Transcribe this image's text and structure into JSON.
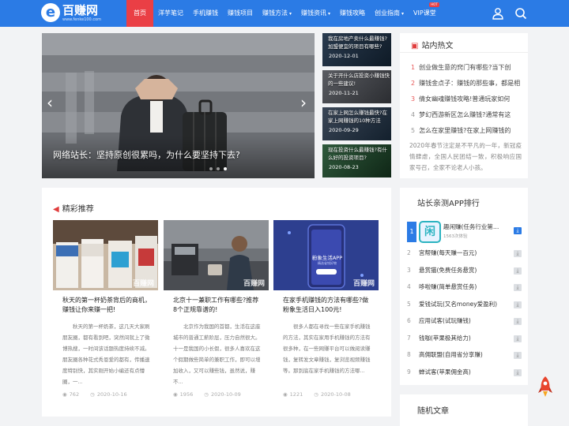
{
  "site": {
    "logo_glyph": "e",
    "name": "百赚网",
    "url": "www.fenke100.com"
  },
  "nav": {
    "items": [
      {
        "label": "首页",
        "active": true
      },
      {
        "label": "洋芋笔记"
      },
      {
        "label": "手机赚钱"
      },
      {
        "label": "赚钱项目"
      },
      {
        "label": "赚钱方法",
        "dropdown": true
      },
      {
        "label": "赚钱资讯",
        "dropdown": true
      },
      {
        "label": "赚钱攻略"
      },
      {
        "label": "创业指南",
        "dropdown": true
      },
      {
        "label": "VIP课堂",
        "badge": "HOT"
      }
    ],
    "icons": [
      "user-icon",
      "search-icon"
    ]
  },
  "slider": {
    "caption": "网络站长：坚持原创很累吗，为什么要坚持下去?",
    "prev": "‹",
    "next": "›",
    "active_index": 2,
    "dot_count": 3
  },
  "side_posts": [
    {
      "title": "我在房地产卖什么最赚钱?加盟便宜的项目有哪些?",
      "date": "2020-12-01"
    },
    {
      "title": "关于开什么店投资小赚钱快的一些建议!",
      "date": "2020-11-21"
    },
    {
      "title": "在家上网怎么赚钱最快?在家上网赚钱的10种方法",
      "date": "2020-09-29"
    },
    {
      "title": "现在投资什么最赚钱?有什么好的投资项目?",
      "date": "2020-08-23"
    }
  ],
  "hot": {
    "title": "站内热文",
    "items": [
      "创业做生意的窍门有哪些?当下创",
      "赚钱金点子：赚钱的那些事，都是相",
      "倩女幽魂赚钱攻略!普通玩家如何",
      "梦幻西游新区怎么赚钱?通常有这",
      "怎么在家里赚钱?在家上网赚钱的"
    ],
    "excerpt": "2020年春节注定是不平凡的一年，新冠疫情肆虐，全国人民团结一致，积极响应国家号召，全家不论老人小孩。"
  },
  "featured": {
    "title": "精彩推荐",
    "cards": [
      {
        "watermark": "百赚网",
        "title": "秋天的第一杯奶茶背后的商机，赚钱让你来赚一把!",
        "excerpt": "秋天的第一杯奶茶，这几天大家刷朋友圈，都有看到吧，突然间就上了微博热搜，一时间该话题热度持续不减。朋友圈各种花式秀恩爱的都有，传播速度特别快，其实刚开始小编还有点懵圈，一...",
        "views": "762",
        "date": "2020-10-16"
      },
      {
        "watermark": "百赚网",
        "title": "北京十一兼职工作有哪些?推荐8个正规靠谱的!",
        "excerpt": "北京作为我国的首都，生活在这座城市的普通工薪阶层，压力自然很大。十一是我国的小长假，很多人喜欢在这个假期做些简单的兼职工作，即可以增加收入，又可以赚些钱，虽然说，赚不...",
        "views": "1956",
        "date": "2020-10-09"
      },
      {
        "watermark": "百赚网",
        "title": "在家手机赚钱的方法有哪些?做粉象生活日入100元!",
        "excerpt": "很多人都在寻找一些在家手机赚钱的方法，其实在家用手机赚钱的方法有很多种，在一些网赚平台可以做阅读赚钱，复转发文章赚钱，复浏览视频赚钱等。那到底在家手机赚钱的方法哪...",
        "views": "1221",
        "date": "2020-10-08",
        "app_name": "粉象生活APP",
        "app_sub": "精选省钱好物"
      }
    ]
  },
  "ranking": {
    "title": "站长亲测APP排行",
    "top": {
      "rank": "1",
      "name": "趣闲赚(任务行业第…",
      "sub": "1563次体验",
      "icon": "闲"
    },
    "items": [
      {
        "rank": "2",
        "name": "宫帮赚(每天赚一百元)"
      },
      {
        "rank": "3",
        "name": "悬赏猫(免费任务悬赏)"
      },
      {
        "rank": "4",
        "name": "哆啦赚(简单悬赏任务)"
      },
      {
        "rank": "5",
        "name": "爱钱试玩(又名money爱盈利)"
      },
      {
        "rank": "6",
        "name": "应用试客(试玩赚钱)"
      },
      {
        "rank": "7",
        "name": "钱咖(苹果极其给力)"
      },
      {
        "rank": "8",
        "name": "高佣联盟(自用省分享赚)"
      },
      {
        "rank": "9",
        "name": "蝉试客(苹果佣金高)"
      }
    ]
  },
  "random": {
    "title": "随机文章"
  },
  "colors": {
    "brand": "#2b7be5",
    "accent": "#ea3f45",
    "background": "#f2f3f5"
  }
}
